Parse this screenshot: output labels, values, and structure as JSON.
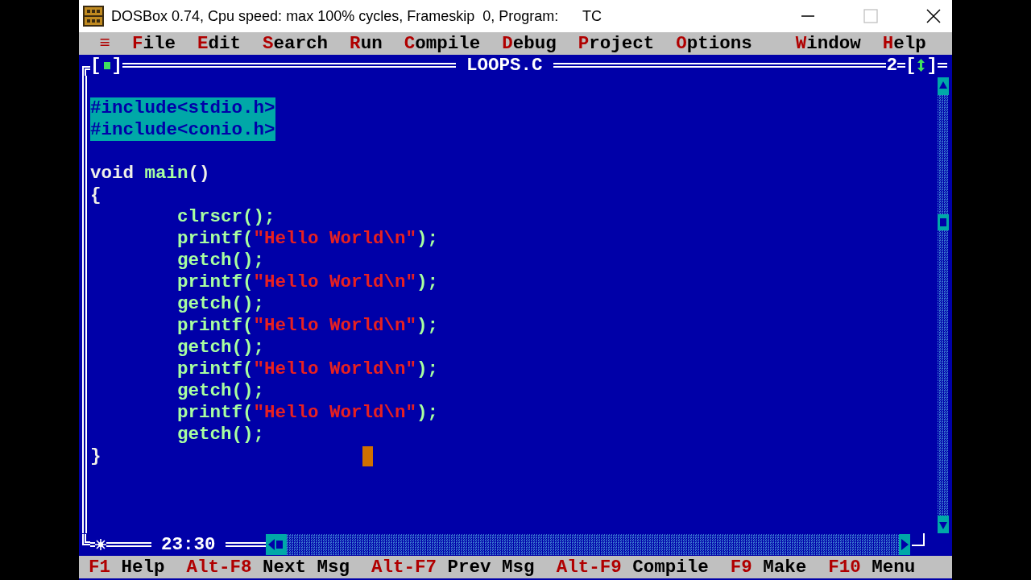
{
  "window": {
    "title": "DOSBox 0.74, Cpu speed: max 100% cycles, Frameskip  0, Program:      TC"
  },
  "menu": {
    "system": "≡",
    "items": [
      {
        "hotkey": "F",
        "rest": "ile"
      },
      {
        "hotkey": "E",
        "rest": "dit"
      },
      {
        "hotkey": "S",
        "rest": "earch"
      },
      {
        "hotkey": "R",
        "rest": "un"
      },
      {
        "hotkey": "C",
        "rest": "ompile"
      },
      {
        "hotkey": "D",
        "rest": "ebug"
      },
      {
        "hotkey": "P",
        "rest": "roject"
      },
      {
        "hotkey": "O",
        "rest": "ptions"
      },
      {
        "hotkey": "W",
        "rest": "indow",
        "kind": "right"
      },
      {
        "hotkey": "H",
        "rest": "elp"
      }
    ]
  },
  "editor": {
    "file_name": "LOOPS.C",
    "window_number": "2",
    "close_box": {
      "open": "[",
      "close": "]"
    },
    "zoom_box": {
      "open": "[",
      "close": "]"
    },
    "modified": true,
    "position": "23:30",
    "lines": [
      {
        "kind": "blank"
      },
      [
        {
          "kind": "selected",
          "text": "#include<stdio.h>"
        }
      ],
      [
        {
          "kind": "selected",
          "text": "#include<conio.h>"
        }
      ],
      {
        "kind": "blank"
      },
      [
        {
          "kind": "plain",
          "text": "void "
        },
        {
          "kind": "code",
          "text": "main"
        },
        {
          "kind": "plain",
          "text": "()"
        }
      ],
      [
        {
          "kind": "plain",
          "text": "{"
        }
      ],
      [
        {
          "kind": "code",
          "text": "\tclrscr();"
        }
      ],
      [
        {
          "kind": "code",
          "text": "\tprintf("
        },
        {
          "kind": "string",
          "text": "\"Hello World\\n\""
        },
        {
          "kind": "code",
          "text": ");"
        }
      ],
      [
        {
          "kind": "code",
          "text": "\tgetch();"
        }
      ],
      [
        {
          "kind": "code",
          "text": "\tprintf("
        },
        {
          "kind": "string",
          "text": "\"Hello World\\n\""
        },
        {
          "kind": "code",
          "text": ");"
        }
      ],
      [
        {
          "kind": "code",
          "text": "\tgetch();"
        }
      ],
      [
        {
          "kind": "code",
          "text": "\tprintf("
        },
        {
          "kind": "string",
          "text": "\"Hello World\\n\""
        },
        {
          "kind": "code",
          "text": ");"
        }
      ],
      [
        {
          "kind": "code",
          "text": "\tgetch();"
        }
      ],
      [
        {
          "kind": "code",
          "text": "\tprintf("
        },
        {
          "kind": "string",
          "text": "\"Hello World\\n\""
        },
        {
          "kind": "code",
          "text": ");"
        }
      ],
      [
        {
          "kind": "code",
          "text": "\tgetch();"
        }
      ],
      [
        {
          "kind": "code",
          "text": "\tprintf("
        },
        {
          "kind": "string",
          "text": "\"Hello World\\n\""
        },
        {
          "kind": "code",
          "text": ");"
        }
      ],
      [
        {
          "kind": "code",
          "text": "\tgetch();"
        }
      ],
      [
        {
          "kind": "plain",
          "text": "}"
        },
        {
          "kind": "cursor"
        }
      ]
    ]
  },
  "status_bar": [
    {
      "key": "F1",
      "label": "Help"
    },
    {
      "key": "Alt-F8",
      "label": "Next Msg"
    },
    {
      "key": "Alt-F7",
      "label": "Prev Msg"
    },
    {
      "key": "Alt-F9",
      "label": "Compile"
    },
    {
      "key": "F9",
      "label": "Make"
    },
    {
      "key": "F10",
      "label": "Menu"
    }
  ]
}
